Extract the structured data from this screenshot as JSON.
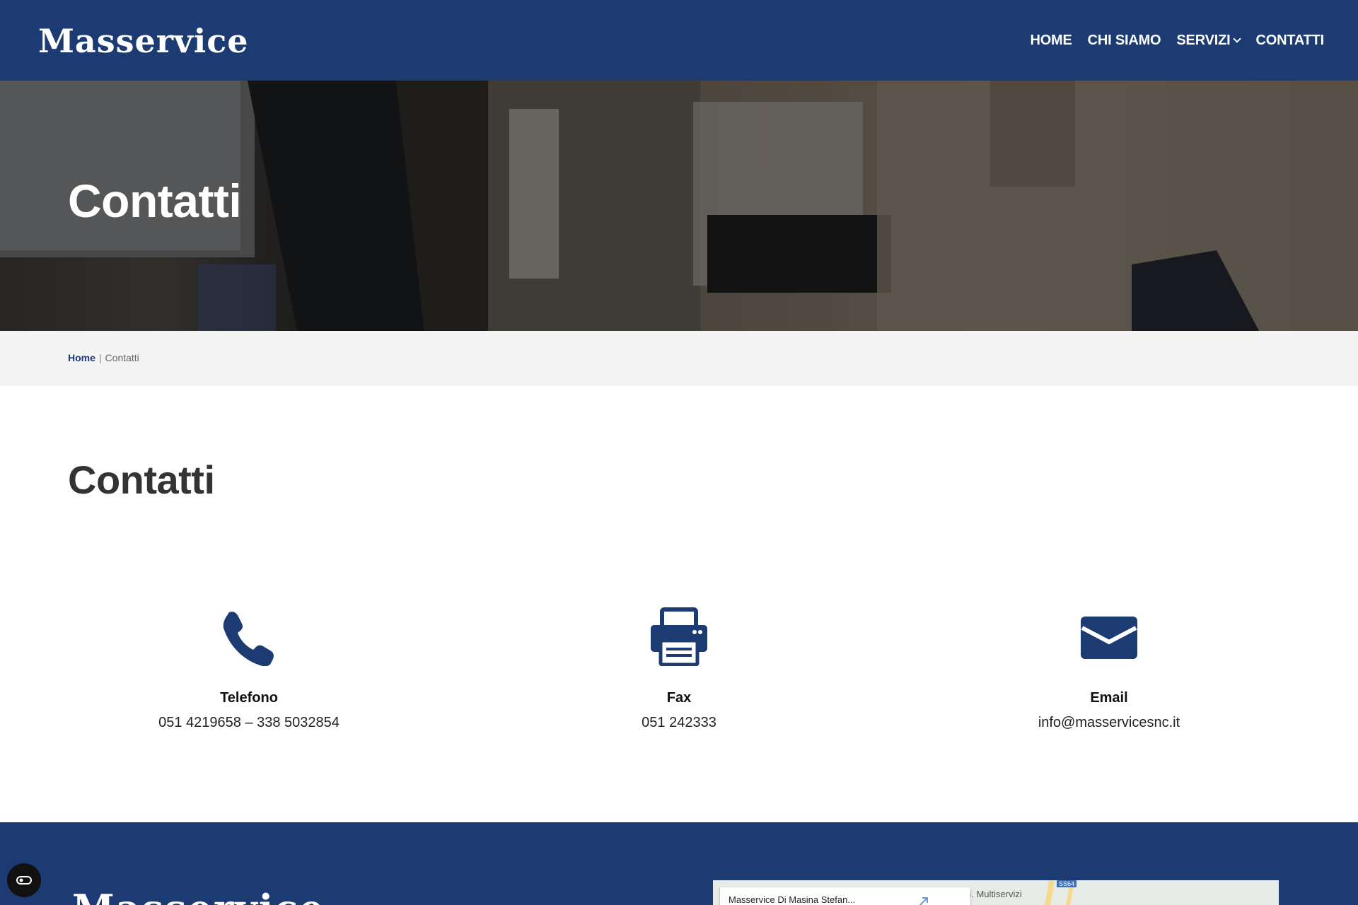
{
  "brand": {
    "logo_text": "Masservice"
  },
  "nav": {
    "items": [
      {
        "label": "HOME"
      },
      {
        "label": "CHI SIAMO"
      },
      {
        "label": "SERVIZI"
      },
      {
        "label": "CONTATTI"
      }
    ]
  },
  "hero": {
    "title": "Contatti"
  },
  "breadcrumb": {
    "home": "Home",
    "separator": "|",
    "current": "Contatti"
  },
  "content": {
    "title": "Contatti",
    "contacts": [
      {
        "icon": "phone-icon",
        "label": "Telefono",
        "value": "051 4219658 – 338 5032854"
      },
      {
        "icon": "printer-icon",
        "label": "Fax",
        "value": "051 242333"
      },
      {
        "icon": "envelope-icon",
        "label": "Email",
        "value": "info@masservicesnc.it"
      }
    ]
  },
  "footer": {
    "logo_text": "Masservice",
    "map": {
      "place_name": "Masservice Di Masina Stefan...",
      "nearby_label": "3. Multiservizi",
      "road_badge": "SS64"
    }
  },
  "colors": {
    "primary": "#1d3b73",
    "breadcrumb_bg": "#f4f4f4",
    "text_dark": "#333333"
  }
}
